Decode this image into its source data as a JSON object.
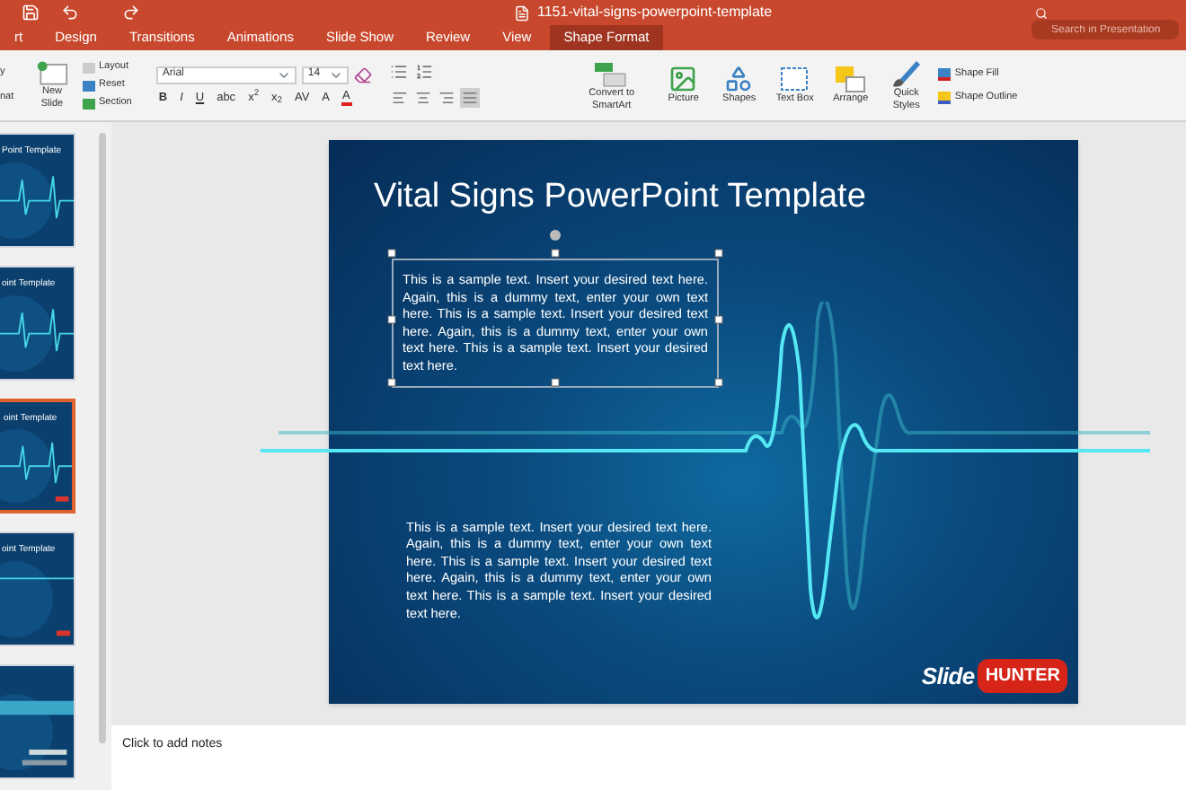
{
  "window": {
    "title": "1151-vital-signs-powerpoint-template",
    "search": {
      "placeholder": "Search in Presentation"
    }
  },
  "tabs": [
    {
      "label": "rt",
      "selected": false
    },
    {
      "label": "Design",
      "selected": false
    },
    {
      "label": "Transitions",
      "selected": false
    },
    {
      "label": "Animations",
      "selected": false
    },
    {
      "label": "Slide Show",
      "selected": false
    },
    {
      "label": "Review",
      "selected": false
    },
    {
      "label": "View",
      "selected": false
    },
    {
      "label": "Shape Format",
      "selected": true
    }
  ],
  "ribbon": {
    "clipboard": [
      "y",
      "nat"
    ],
    "new_slide": "New Slide",
    "slide_buttons": [
      "Layout",
      "Reset",
      "Section"
    ],
    "font": {
      "name": "Arial",
      "size": "14"
    },
    "font_buttons": [
      "B",
      "I",
      "U",
      "abc",
      "x$^{2}$",
      "x$_{2}$",
      "AV",
      "A",
      "A"
    ],
    "alignment": [
      {
        "selected": false
      },
      {
        "selected": false
      },
      {
        "selected": false
      },
      {
        "selected": true
      }
    ],
    "insert_buttons": [
      "Convert to SmartArt",
      "Picture",
      "Shapes",
      "Text Box",
      "Arrange",
      "Quick Styles"
    ],
    "shape_buttons": [
      "Shape Fill",
      "Shape Outline"
    ]
  },
  "thumbnails": [
    {
      "title": "Point Template",
      "selected": false
    },
    {
      "title": "oint Template",
      "selected": false
    },
    {
      "title": "oint Template",
      "selected": true
    },
    {
      "title": "oint Template",
      "selected": false
    },
    {
      "selected": false
    }
  ],
  "slide": {
    "title": "Vital Signs PowerPoint Template",
    "text_boxes": [
      {
        "text": "This is a sample text. Insert your desired text here. Again, this is a dummy text, enter your own text here. This is a sample text. Insert your desired text here. Again, this is a dummy text, enter your own text here. This is a sample text. Insert your desired text here.",
        "selected": true
      },
      {
        "text": "This is a sample text. Insert your desired text here. Again, this is a dummy text, enter your own text here. This is a sample text. Insert your desired text here. Again, this is a dummy text, enter your own text here. This is a sample text. Insert your desired text here.",
        "selected": false
      }
    ],
    "logo": {
      "word": "Slide",
      "badge": "HUNTER"
    }
  },
  "notes": {
    "placeholder": "Click to add notes"
  }
}
